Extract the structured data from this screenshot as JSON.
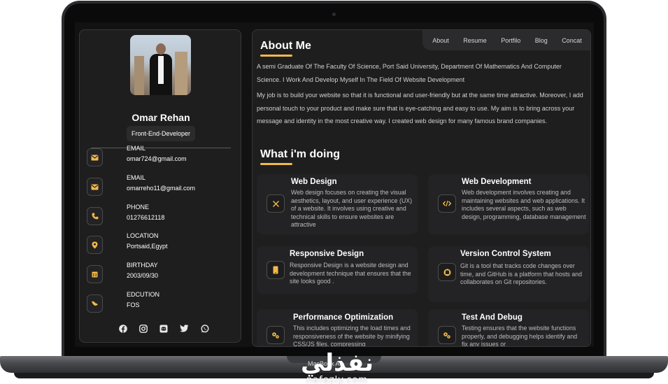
{
  "device": {
    "base_label": "MacBook Air"
  },
  "profile": {
    "name": "Omar Rehan",
    "role": "Front-End-Developer"
  },
  "contacts": [
    {
      "label": "EMAIL",
      "value": "omar724@gmail.com",
      "icon": "mail-icon"
    },
    {
      "label": "EMAIL",
      "value": "omarreho11@gmail.com",
      "icon": "mail-icon"
    },
    {
      "label": "PHONE",
      "value": "01276612118",
      "icon": "phone-icon"
    },
    {
      "label": "LOCATION",
      "value": "Portsaid,Egypt",
      "icon": "location-pin-icon"
    },
    {
      "label": "BIRTHDAY",
      "value": "2003/09/30",
      "icon": "calendar-icon"
    },
    {
      "label": "EDCUTION",
      "value": "FOS",
      "icon": "education-icon"
    }
  ],
  "socials": [
    "facebook-icon",
    "instagram-icon",
    "discord-icon",
    "twitter-icon",
    "whatsapp-icon"
  ],
  "nav": {
    "items": [
      "About",
      "Resume",
      "Portfilo",
      "Blog",
      "Concat"
    ]
  },
  "about": {
    "title": "About Me",
    "paragraph1": "A semi Graduate Of The Faculty Of Science, Port Said University, Department Of Mathematics And Computer Science. I Work And Develop Myself In The Field Of Website Development",
    "paragraph2": "My job is to build your website so that it is functional and user-friendly but at the same time attractive. Moreover, I add personal touch to your product and make sure that is eye-catching and easy to use. My aim is to bring across your message and identity in the most creative way. I created web design for many famous brand companies."
  },
  "doing": {
    "title": "What i'm doing",
    "services": [
      {
        "title": "Web Design",
        "desc": "Web design focuses on creating the visual aesthetics, layout, and user experience (UX) of a website. It involves using creative and technical skills to ensure websites are attractive",
        "icon": "design-tools-icon"
      },
      {
        "title": "Web Development",
        "desc": "Web development involves creating and maintaining websites and web applications. It includes several aspects, such as web design, programming, database management",
        "icon": "code-icon"
      },
      {
        "title": "Responsive Design",
        "desc": "Responsive Design is a website design and development technique that ensures that the site looks good .",
        "icon": "mobile-icon"
      },
      {
        "title": "Version Control System",
        "desc": "Git is a tool that tracks code changes over time, and GitHub is a platform that hosts and collaborates on Git repositories.",
        "icon": "github-icon"
      },
      {
        "title": "Performance Optimization",
        "desc": "This includes optimizing the load times and responsiveness of the website by minifying CSS/JS files, compressing",
        "icon": "gears-icon"
      },
      {
        "title": "Test And Debug",
        "desc": "Testing ensures that the website functions properly, and debugging helps identify and fix any issues or",
        "icon": "gears-icon"
      }
    ]
  },
  "watermark": {
    "arabic": "نفذلي",
    "latin": "nafezly.com"
  },
  "colors": {
    "accent": "#f2b94a",
    "panel": "#1e1e1f",
    "screen": "#121212"
  }
}
